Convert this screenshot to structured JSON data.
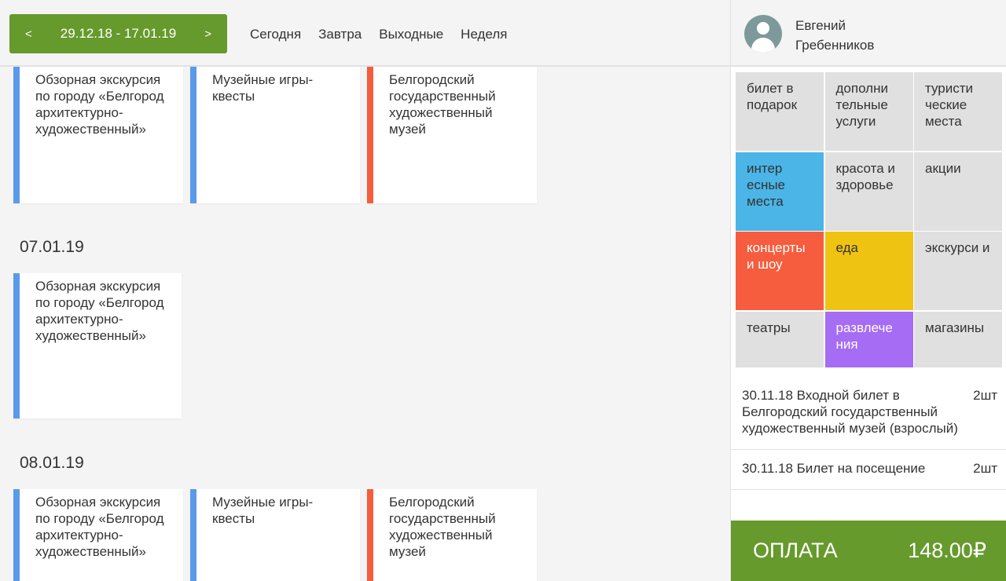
{
  "toolbar": {
    "prev": "<",
    "next": ">",
    "date_range": "29.12.18 - 17.01.19",
    "quick_links": [
      "Сегодня",
      "Завтра",
      "Выходные",
      "Неделя"
    ]
  },
  "groups": [
    {
      "date": "",
      "cards": [
        {
          "title": "Обзорная экскурсия по городу «Белгород архитектурно-художественный»",
          "accent": "#5a9ae8"
        },
        {
          "title": "Музейные игры-квесты",
          "accent": "#5a9ae8"
        },
        {
          "title": "Белгородский государственный художественный музей",
          "accent": "#f55d3e"
        }
      ]
    },
    {
      "date": "07.01.19",
      "cards": [
        {
          "title": "Обзорная экскурсия по городу «Белгород архитектурно-художественный»",
          "accent": "#5a9ae8"
        }
      ]
    },
    {
      "date": "08.01.19",
      "cards": [
        {
          "title": "Обзорная экскурсия по городу «Белгород архитектурно-художественный»",
          "accent": "#5a9ae8"
        },
        {
          "title": "Музейные игры-квесты",
          "accent": "#5a9ae8"
        },
        {
          "title": "Белгородский государственный художественный музей",
          "accent": "#f55d3e"
        }
      ]
    }
  ],
  "user": {
    "first_name": "Евгений",
    "last_name": "Гребенников",
    "icon": "user-avatar-icon"
  },
  "categories": [
    {
      "label": "билет в подарок",
      "color": "#e0e0e0"
    },
    {
      "label": "дополни тельные услуги",
      "color": "#e0e0e0"
    },
    {
      "label": "туристи ческие места",
      "color": "#e0e0e0"
    },
    {
      "label": "интер есные места",
      "color": "#4ab5e6"
    },
    {
      "label": "красота и здоровье",
      "color": "#e0e0e0"
    },
    {
      "label": "акции",
      "color": "#e0e0e0"
    },
    {
      "label": "концерты и шоу",
      "color": "#f55d3e"
    },
    {
      "label": "еда",
      "color": "#efc312"
    },
    {
      "label": "экскурси и",
      "color": "#e0e0e0"
    },
    {
      "label": "театры",
      "color": "#e0e0e0"
    },
    {
      "label": "развлече ния",
      "color": "#a66cf3"
    },
    {
      "label": "магазины",
      "color": "#e0e0e0"
    }
  ],
  "order": [
    {
      "name": "30.11.18 Входной билет в Белгородский государственный художественный музей (взрослый)",
      "qty": "2шт"
    },
    {
      "name": "30.11.18 Билет на посещение",
      "qty": "2шт"
    }
  ],
  "payment": {
    "label": "ОПЛАТА",
    "amount": "148.00₽",
    "color": "#669a2c"
  }
}
